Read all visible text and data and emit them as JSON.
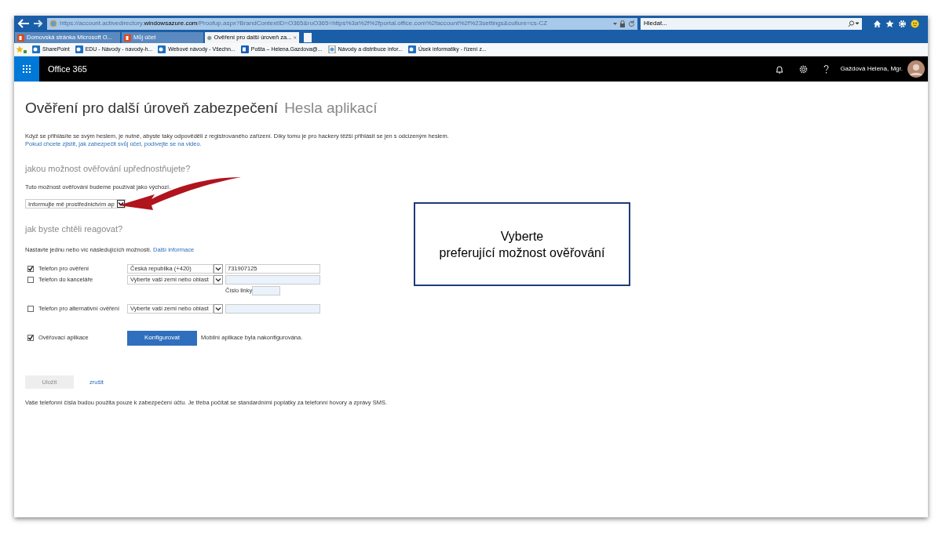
{
  "browser": {
    "url_prefix": "https://account.activedirectory.",
    "url_domain": "windowsazure.com",
    "url_rest": "/Proofup.aspx?BrandContextID=O365&ruO365=https%3a%2f%2fportal.office.com%2faccount%2f%23settings&culture=cs-CZ",
    "search_placeholder": "Hledat...",
    "tabs": [
      {
        "label": "Domovská stránka Microsoft O...",
        "selected": false
      },
      {
        "label": "Můj účet",
        "selected": false
      },
      {
        "label": "Ověření pro další úroveň za...",
        "selected": true
      }
    ],
    "favorites": [
      {
        "label": "SharePoint",
        "kind": "sp"
      },
      {
        "label": "EDU - Návody - navody-h...",
        "kind": "sp"
      },
      {
        "label": "Webové návody - Všechn...",
        "kind": "sp"
      },
      {
        "label": "Pošta – Helena.Gazdova@...",
        "kind": "mail"
      },
      {
        "label": "Návody a distribuce infor...",
        "kind": "page"
      },
      {
        "label": "Úsek informatiky - řízení z...",
        "kind": "sp"
      }
    ]
  },
  "app_bar": {
    "title": "Office 365",
    "user": "Gaždová Helena, Mgr."
  },
  "page": {
    "heading": "Ověření pro další úroveň zabezpečení",
    "heading_secondary": "Hesla aplikací",
    "intro": "Když se přihlásíte se svým heslem, je nutné, abyste taky odpověděli z registrovaného zařízení. Díky tomu je pro hackery těžší přihlásit se jen s odcizeným heslem.",
    "intro_link": "Pokud chcete zjistit, jak zabezpečit svůj účet, podívejte se na video.",
    "preferred_heading": "jakou možnost ověřování upřednostňujete?",
    "preferred_text": "Tuto možnost ověřování budeme používat jako výchozí.",
    "preferred_value": "Informujte mě prostřednictvím ap",
    "respond_heading": "jak byste chtěli reagovat?",
    "respond_text": "Nastavte jednu nebo víc následujících možností.",
    "respond_link": "Další informace",
    "methods": [
      {
        "kind": "phone",
        "label": "Telefon pro ověření",
        "checked": true,
        "country": "Česká republika (+420)",
        "number": "731907125"
      },
      {
        "kind": "phone",
        "label": "Telefon do kanceláře",
        "checked": false,
        "country": "Vyberte vaši zemi nebo oblast",
        "extension_label": "Číslo linky"
      },
      {
        "kind": "phone",
        "label": "Telefon pro alternativní ověření",
        "checked": false,
        "country": "Vyberte vaši zemi nebo oblast"
      },
      {
        "kind": "app",
        "label": "Ověřovací aplikace",
        "checked": true,
        "button": "Konfigurovat",
        "note": "Mobilní aplikace byla nakonfigurována."
      }
    ],
    "save": {
      "label": "Uložit",
      "disabled": true
    },
    "cancel": "zrušit",
    "footer": "Vaše telefonní čísla budou použita pouze k zabezpečení účtu. Je třeba počítat se standardními poplatky za telefonní hovory a zprávy SMS."
  },
  "callout": {
    "lines": [
      "Vyberte",
      "preferující možnost ověřování"
    ]
  }
}
